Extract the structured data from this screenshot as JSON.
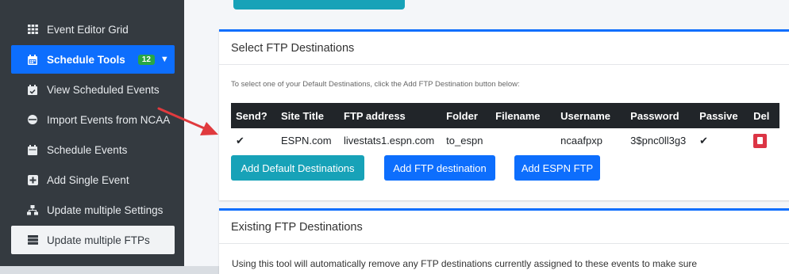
{
  "sidebar": {
    "items": [
      {
        "label": "Event Editor Grid",
        "icon": "grid-icon"
      },
      {
        "label": "Schedule Tools",
        "icon": "calendar-icon",
        "badge": "12"
      },
      {
        "label": "View Scheduled Events",
        "icon": "calendar-check-icon"
      },
      {
        "label": "Import Events from NCAA",
        "icon": "circle-icon"
      },
      {
        "label": "Schedule Events",
        "icon": "calendar-icon"
      },
      {
        "label": "Add Single Event",
        "icon": "plus-square-icon"
      },
      {
        "label": "Update multiple Settings",
        "icon": "sitemap-icon"
      },
      {
        "label": "Update multiple FTPs",
        "icon": "server-icon"
      }
    ]
  },
  "select_card": {
    "title": "Select FTP Destinations",
    "hint": "To select one of your Default Destinations, click the Add FTP Destination button below:",
    "table": {
      "headers": [
        "Send?",
        "Site Title",
        "FTP address",
        "Folder",
        "Filename",
        "Username",
        "Password",
        "Passive",
        "Del"
      ],
      "rows": [
        {
          "send": "✔",
          "site_title": "ESPN.com",
          "ftp_address": "livestats1.espn.com",
          "folder": "to_espn",
          "filename": "",
          "username": "ncaafpxp",
          "password": "3$pnc0ll3g3",
          "passive": "✔"
        }
      ]
    },
    "buttons": {
      "add_default": "Add Default Destinations",
      "add_ftp": "Add FTP destination",
      "add_espn": "Add ESPN FTP"
    }
  },
  "existing_card": {
    "title": "Existing FTP Destinations",
    "text": "Using this tool will automatically remove any FTP destinations currently assigned to these events to make sure"
  },
  "colors": {
    "sidebar_bg": "#343a40",
    "active_blue": "#0d6efd",
    "badge_green": "#28a745",
    "teal": "#17a2b8",
    "danger": "#dc3545",
    "arrow": "#e03a3e"
  }
}
